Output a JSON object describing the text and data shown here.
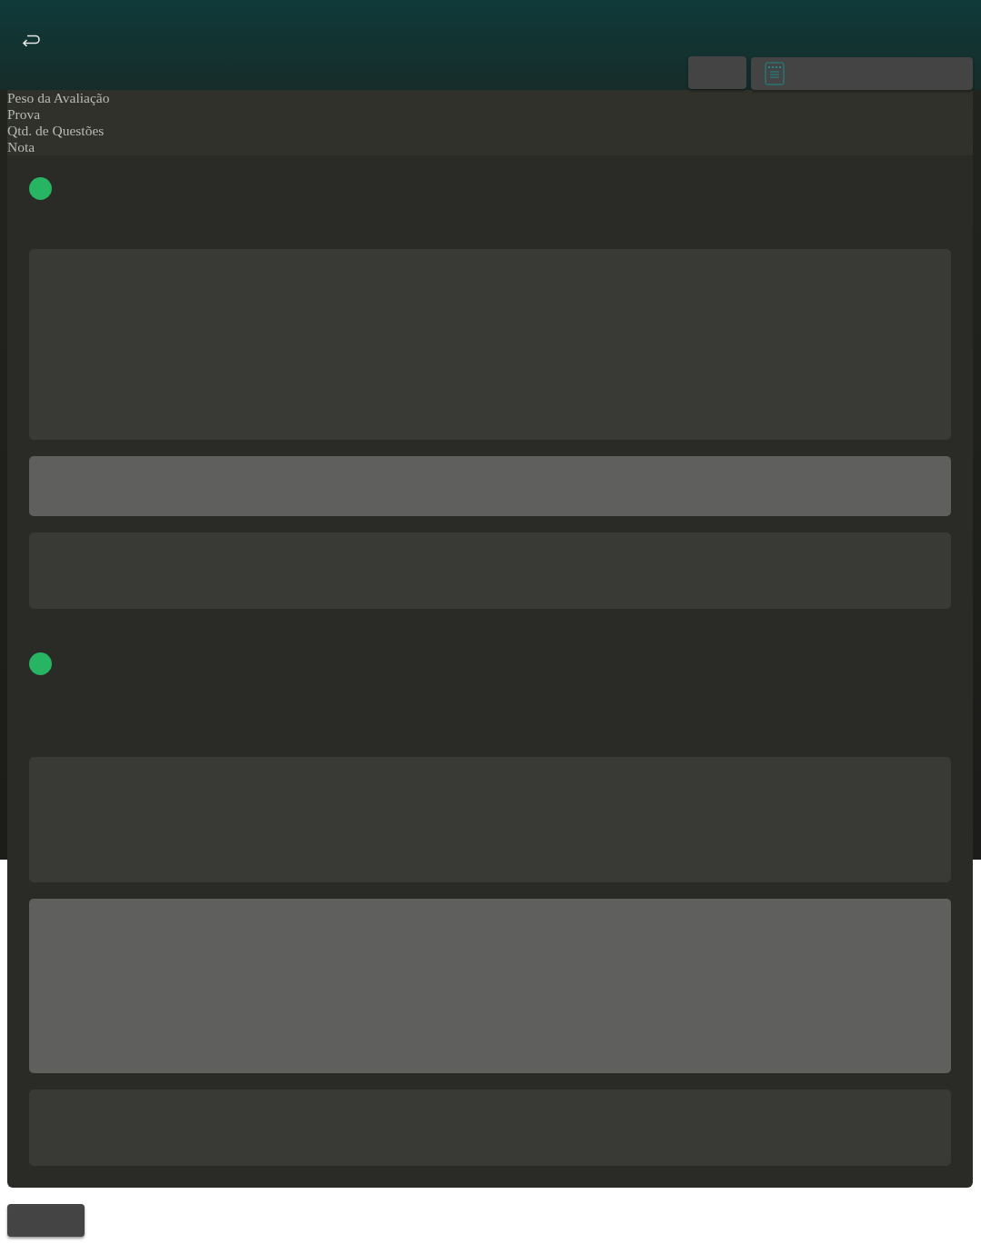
{
  "header": {
    "labels": [
      "Peso da Avaliação",
      "Prova",
      "Qtd. de Questões",
      "Nota"
    ]
  },
  "cards": [
    {
      "color": "#27b463",
      "blocks": [
        {
          "kind": "dark"
        },
        {
          "kind": "light"
        },
        {
          "kind": "dark"
        }
      ]
    },
    {
      "color": "#27b463",
      "blocks": [
        {
          "kind": "dark"
        },
        {
          "kind": "light"
        },
        {
          "kind": "dark"
        }
      ]
    }
  ]
}
